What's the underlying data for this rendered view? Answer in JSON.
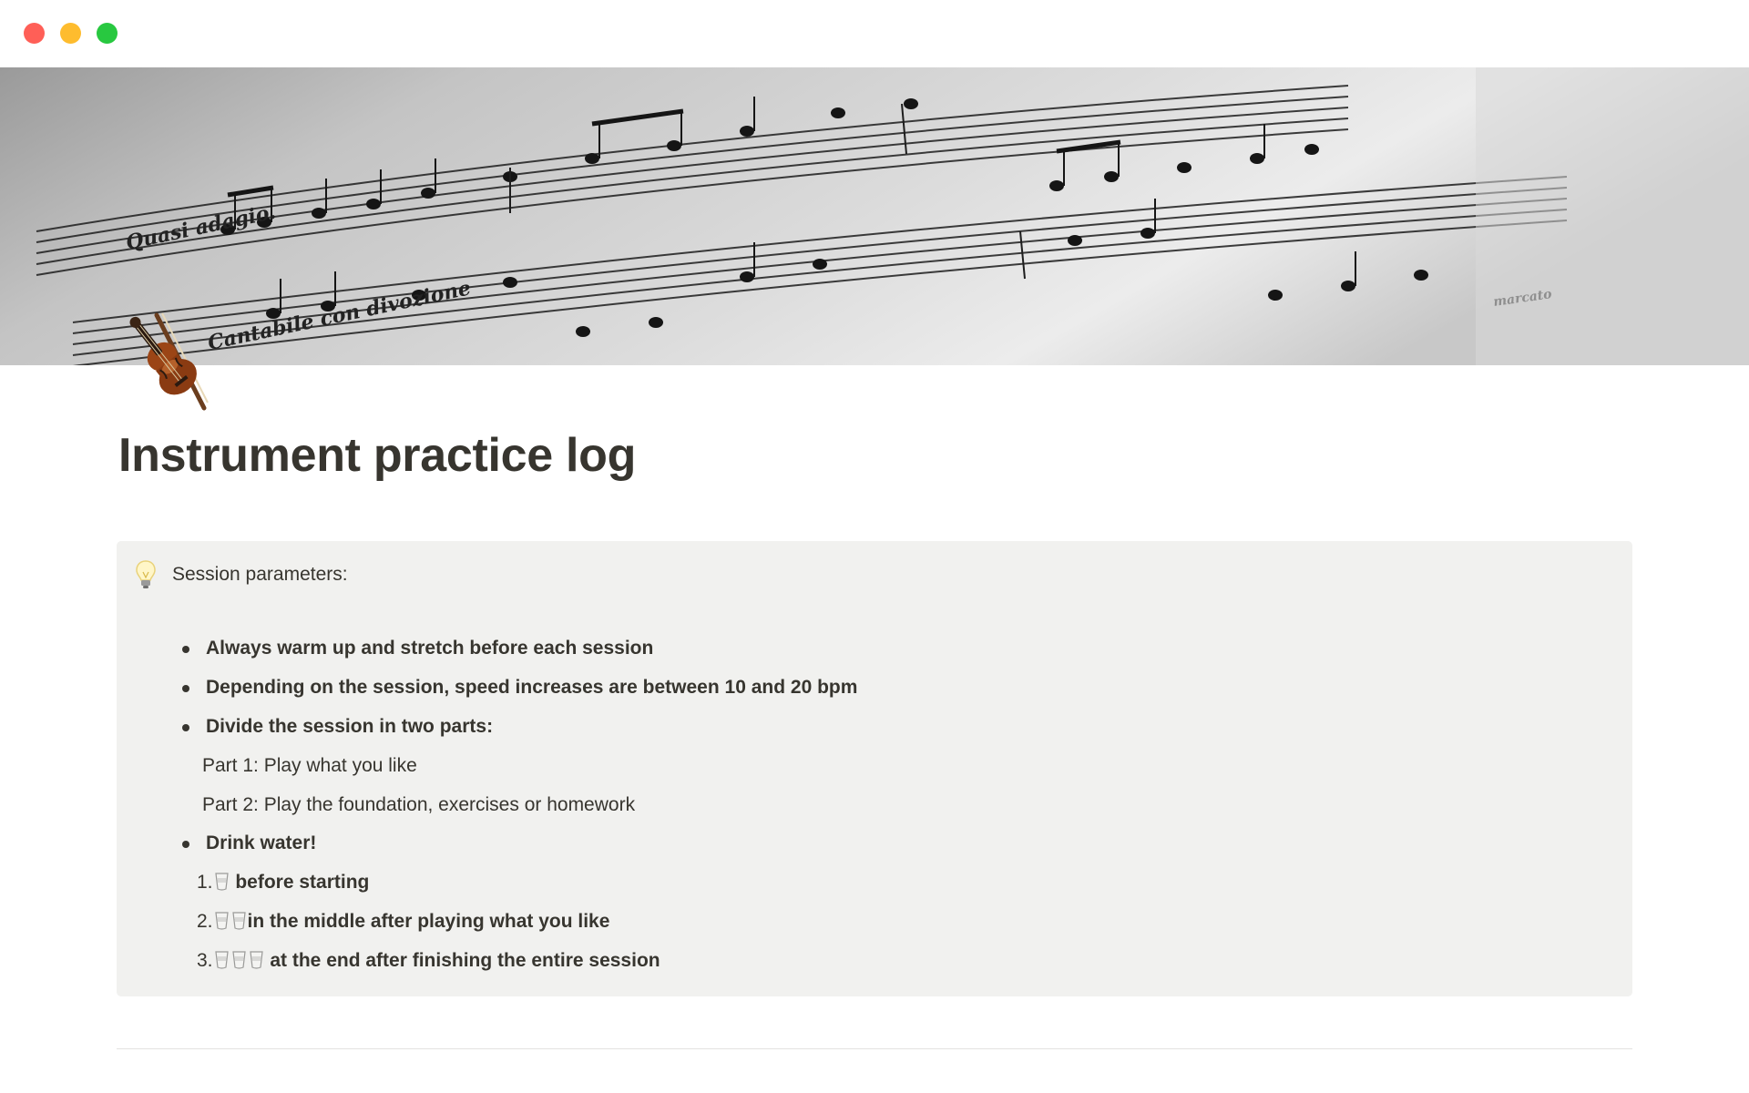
{
  "window": {
    "controls": [
      {
        "name": "close",
        "color": "#ff5f57"
      },
      {
        "name": "minimize",
        "color": "#febc2e"
      },
      {
        "name": "zoom",
        "color": "#28c840"
      }
    ]
  },
  "cover": {
    "image": "sheet-music-photo",
    "annotations": [
      "Quasi adagio.",
      "Cantabile con divozione",
      "marcato"
    ]
  },
  "page": {
    "icon": "violin-icon",
    "title": "Instrument practice log"
  },
  "callout": {
    "icon": "lightbulb-icon",
    "background": "#f1f1ef",
    "heading": "Session parameters:",
    "bullets": {
      "warm_up": "Always warm up and stretch before each session",
      "speed": "Depending on the session, speed increases are between 10 and 20 bpm",
      "divide": "Divide the session in two parts:",
      "drink": "Drink water!"
    },
    "parts": {
      "part1": "Part 1:  Play what you like",
      "part2": "Part 2: Play the foundation, exercises or homework"
    },
    "water_steps": [
      {
        "number": "1.",
        "cups": 1,
        "cup_icon": "cup-icon",
        "text": " before starting"
      },
      {
        "number": "2.",
        "cups": 2,
        "cup_icon": "cup-icon",
        "text": "in the middle after playing what you like"
      },
      {
        "number": "3.",
        "cups": 3,
        "cup_icon": "cup-icon",
        "text": " at the end after finishing the entire session"
      }
    ]
  }
}
